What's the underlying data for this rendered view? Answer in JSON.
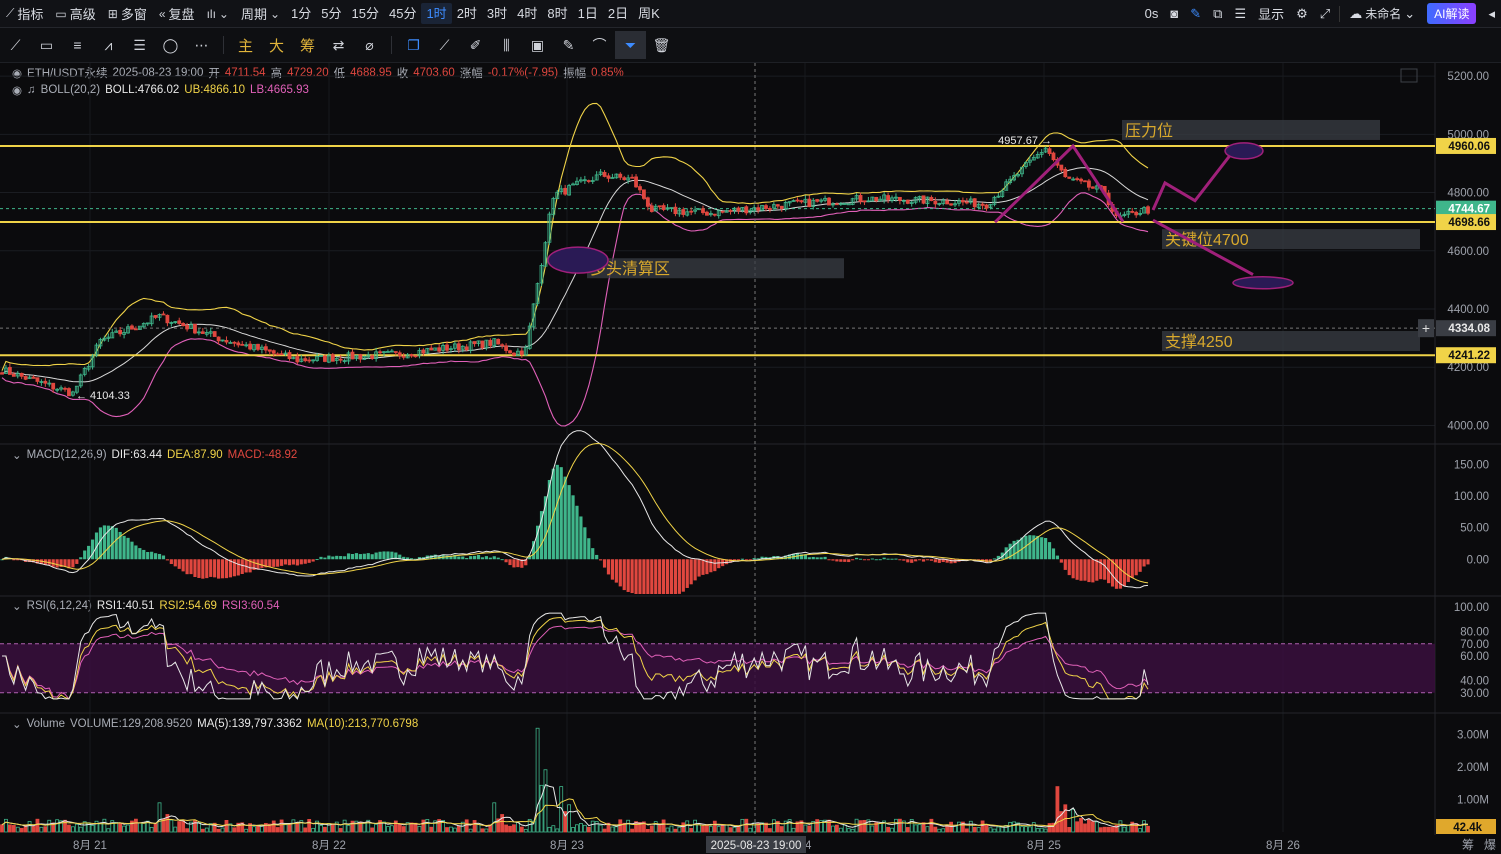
{
  "topbar": {
    "items": [
      {
        "icon": "indicator-icon",
        "label": "指标"
      },
      {
        "icon": "calendar-icon",
        "label": "高级"
      },
      {
        "icon": "grid-icon",
        "label": "多窗"
      },
      {
        "icon": "replay-icon",
        "label": "复盘"
      },
      {
        "icon": "candle-type-icon",
        "label": ""
      },
      {
        "icon": "",
        "label": "周期"
      }
    ],
    "timeframes": [
      "1分",
      "5分",
      "15分",
      "45分",
      "1时",
      "2时",
      "3时",
      "4时",
      "8时",
      "1日",
      "2日",
      "周K"
    ],
    "active_timeframe": "1时",
    "right": {
      "countdown": "0s",
      "display_label": "显示",
      "account_label": "未命名",
      "ai_label": "AI解读"
    }
  },
  "toolbar": {
    "cn_tools": [
      "主",
      "大",
      "筹"
    ]
  },
  "legend": {
    "symbol": "ETH/USDT永续",
    "datetime": "2025-08-23 19:00",
    "open_label": "开",
    "open": "4711.54",
    "high_label": "高",
    "high": "4729.20",
    "low_label": "低",
    "low": "4688.95",
    "close_label": "收",
    "close": "4703.60",
    "change_label": "涨幅",
    "change": "-0.17%(-7.95)",
    "amp_label": "振幅",
    "amp": "0.85%",
    "boll_name": "BOLL(20,2)",
    "boll": "BOLL:4766.02",
    "ub": "UB:4866.10",
    "lb": "LB:4665.93",
    "macd_name": "MACD(12,26,9)",
    "dif": "DIF:63.44",
    "dea": "DEA:87.90",
    "macd": "MACD:-48.92",
    "rsi_name": "RSI(6,12,24)",
    "rsi1": "RSI1:40.51",
    "rsi2": "RSI2:54.69",
    "rsi3": "RSI3:60.54",
    "vol_name": "Volume",
    "vol": "VOLUME:129,208.9520",
    "ma5": "MA(5):139,797.3362",
    "ma10": "MA(10):213,770.6798"
  },
  "colors": {
    "up": "#3fb68b",
    "down": "#e0473f",
    "boll_mid": "#d9d9d9",
    "boll_ub": "#f0d348",
    "boll_lb": "#e060b8",
    "hline": "#f0d348",
    "draw": "#a0207a"
  },
  "chart_data": {
    "type": "candlestick",
    "price_axis": {
      "ticks": [
        5200,
        5000,
        4800,
        4600,
        4400,
        4200,
        4000
      ],
      "labels": [
        "5200.00",
        "5000.00",
        "4800.00",
        "4600.00",
        "4400.00",
        "4200.00",
        "4000.00"
      ],
      "range": [
        3950,
        5245
      ]
    },
    "time_axis": {
      "labels": [
        "8月 21",
        "8月 22",
        "8月 23",
        "24",
        "8月 25",
        "8月 26"
      ],
      "crosshair_label": "2025-08-23 19:00"
    },
    "price_badges": [
      {
        "value": "4960.06",
        "price": 4960.06,
        "bg": "#f0d348",
        "color": "#111"
      },
      {
        "value": "4744.67",
        "price": 4744.67,
        "bg": "#3fb68b",
        "color": "#fff"
      },
      {
        "value": "4698.66",
        "price": 4698.66,
        "bg": "#f0d348",
        "color": "#111"
      },
      {
        "value": "4334.08",
        "price": 4334.08,
        "bg": "#3a3d44",
        "color": "#e8e8e8"
      },
      {
        "value": "4241.22",
        "price": 4241.22,
        "bg": "#f0d348",
        "color": "#111"
      }
    ],
    "horizontal_lines": [
      4960.06,
      4698.66,
      4241.22
    ],
    "annotations": [
      {
        "text": "压力位",
        "price": 5015
      },
      {
        "text": "关键位4700",
        "price": 4640
      },
      {
        "text": "支撑4250",
        "price": 4290
      },
      {
        "text": "多头清算区",
        "price": 4540
      }
    ],
    "high_marker": "4957.67",
    "low_marker": "4104.33",
    "anchors": [
      [
        0,
        4190
      ],
      [
        18,
        4110
      ],
      [
        25,
        4290
      ],
      [
        40,
        4375
      ],
      [
        55,
        4300
      ],
      [
        75,
        4225
      ],
      [
        100,
        4245
      ],
      [
        125,
        4285
      ],
      [
        130,
        4250
      ],
      [
        133,
        4260
      ],
      [
        140,
        4790
      ],
      [
        152,
        4860
      ],
      [
        160,
        4845
      ],
      [
        165,
        4740
      ],
      [
        180,
        4730
      ],
      [
        200,
        4760
      ],
      [
        220,
        4780
      ],
      [
        240,
        4770
      ],
      [
        250,
        4760
      ],
      [
        265,
        4955
      ],
      [
        270,
        4850
      ],
      [
        280,
        4800
      ],
      [
        283,
        4710
      ],
      [
        290,
        4740
      ]
    ],
    "macd_axis": {
      "labels": [
        "150.00",
        "100.00",
        "50.00",
        "0.00"
      ],
      "values": [
        150,
        100,
        50,
        0
      ],
      "range": [
        -55,
        165
      ]
    },
    "rsi_axis": {
      "labels": [
        "100.00",
        "80.00",
        "70.00",
        "60.00",
        "40.00",
        "30.00"
      ],
      "values": [
        100,
        80,
        70,
        60,
        40,
        30
      ],
      "band": [
        30,
        70
      ]
    },
    "volume_axis": {
      "labels": [
        "3.00M",
        "2.00M",
        "1.00M"
      ],
      "values": [
        3000000,
        2000000,
        1000000
      ],
      "range": [
        0,
        3300000
      ],
      "last_badge": "42.4k"
    },
    "volume_spikes": [
      [
        136,
        3200000
      ],
      [
        142,
        1400000
      ],
      [
        268,
        1400000
      ],
      [
        272,
        700000
      ],
      [
        125,
        900000
      ],
      [
        40,
        900000
      ]
    ],
    "bottom_labels": [
      "筹",
      "爆"
    ]
  }
}
